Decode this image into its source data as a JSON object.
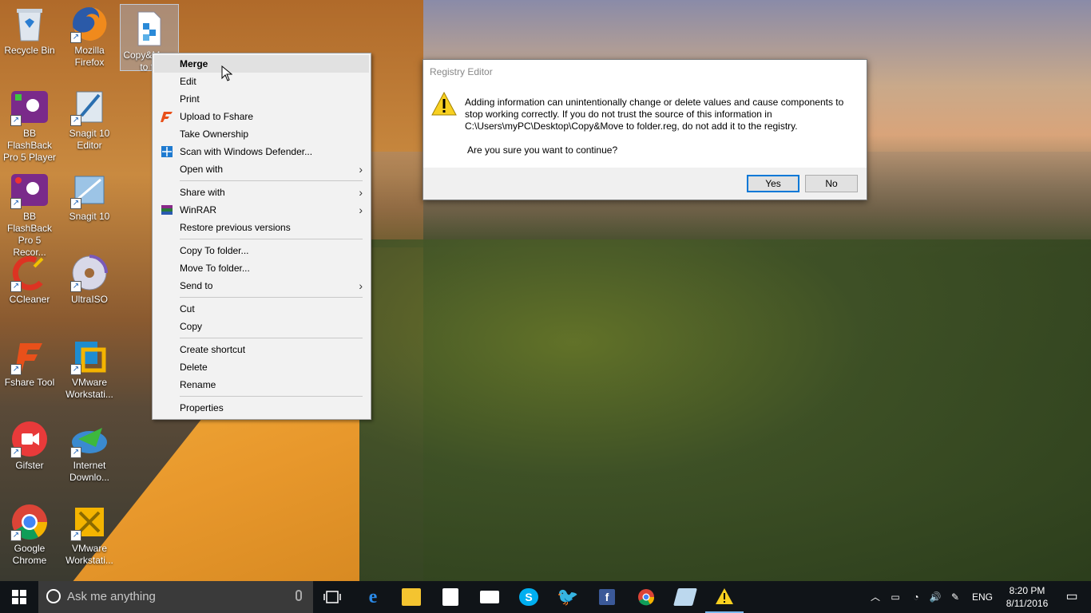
{
  "desktop_icons": [
    {
      "label": "Recycle Bin"
    },
    {
      "label": "Mozilla Firefox"
    },
    {
      "label": "Copy&Move to fo"
    },
    {
      "label": "BB FlashBack Pro 5 Player"
    },
    {
      "label": "Snagit 10 Editor"
    },
    {
      "label": "BB FlashBack Pro 5 Recor..."
    },
    {
      "label": "Snagit 10"
    },
    {
      "label": "CCleaner"
    },
    {
      "label": "UltraISO"
    },
    {
      "label": "Fshare Tool"
    },
    {
      "label": "VMware Workstati..."
    },
    {
      "label": "Gifster"
    },
    {
      "label": "Internet Downlo..."
    },
    {
      "label": "Google Chrome"
    },
    {
      "label": "VMware Workstati..."
    }
  ],
  "context_menu": {
    "items": [
      {
        "label": "Merge"
      },
      {
        "label": "Edit"
      },
      {
        "label": "Print"
      },
      {
        "label": "Upload to Fshare"
      },
      {
        "label": "Take Ownership"
      },
      {
        "label": "Scan with Windows Defender..."
      },
      {
        "label": "Open with"
      },
      {
        "label": "Share with"
      },
      {
        "label": "WinRAR"
      },
      {
        "label": "Restore previous versions"
      },
      {
        "label": "Copy To folder..."
      },
      {
        "label": "Move To folder..."
      },
      {
        "label": "Send to"
      },
      {
        "label": "Cut"
      },
      {
        "label": "Copy"
      },
      {
        "label": "Create shortcut"
      },
      {
        "label": "Delete"
      },
      {
        "label": "Rename"
      },
      {
        "label": "Properties"
      }
    ]
  },
  "dialog": {
    "title": "Registry Editor",
    "message": "Adding information can unintentionally change or delete values and cause components to stop working correctly. If you do not trust the source of this information in C:\\Users\\myPC\\Desktop\\Copy&Move to folder.reg, do not add it to the registry.",
    "question": "Are you sure you want to continue?",
    "yes_label": "Yes",
    "no_label": "No"
  },
  "taskbar": {
    "search_placeholder": "Ask me anything",
    "language": "ENG",
    "time": "8:20 PM",
    "date": "8/11/2016"
  },
  "colors": {
    "accent": "#0078d7",
    "taskbar": "#101418"
  }
}
